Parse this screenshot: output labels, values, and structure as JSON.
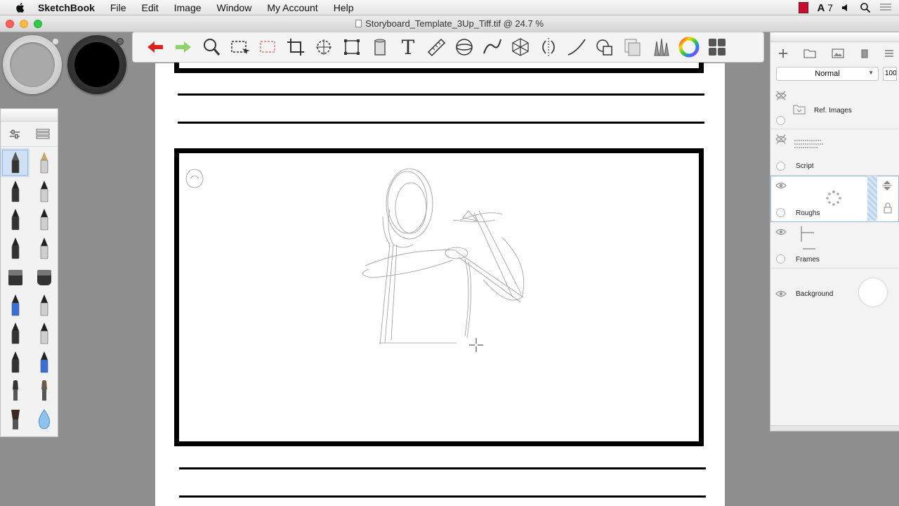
{
  "menubar": {
    "app_name": "SketchBook",
    "items": [
      "File",
      "Edit",
      "Image",
      "Window",
      "My Account",
      "Help"
    ],
    "status": {
      "adobe_count": "7"
    }
  },
  "window": {
    "title": "Storyboard_Template_3Up_Tiff.tif @ 24.7 %"
  },
  "toolbar": {
    "tools": [
      "undo-icon",
      "redo-icon",
      "zoom-icon",
      "select-icon",
      "lasso-select-icon",
      "crop-icon",
      "transform-icon",
      "distort-icon",
      "fill-icon",
      "text-icon",
      "ruler-icon",
      "ellipse-guide-icon",
      "french-curve-icon",
      "perspective-icon",
      "symmetry-icon",
      "stroke-icon",
      "shapes-icon",
      "layer-copy-icon",
      "brushes-icon",
      "color-wheel-icon",
      "palettes-icon"
    ]
  },
  "colors": {
    "undo": "#d9231d",
    "redo": "#8fd36b",
    "secondary_color": "#a9a9a9",
    "primary_color": "#000000"
  },
  "layers": {
    "blend_mode": "Normal",
    "opacity": "100",
    "items": [
      {
        "name": "Ref. Images",
        "visible": false
      },
      {
        "name": "Script",
        "visible": false
      },
      {
        "name": "Roughs",
        "visible": true,
        "selected": true
      },
      {
        "name": "Frames",
        "visible": true
      },
      {
        "name": "Background",
        "visible": true
      }
    ]
  }
}
